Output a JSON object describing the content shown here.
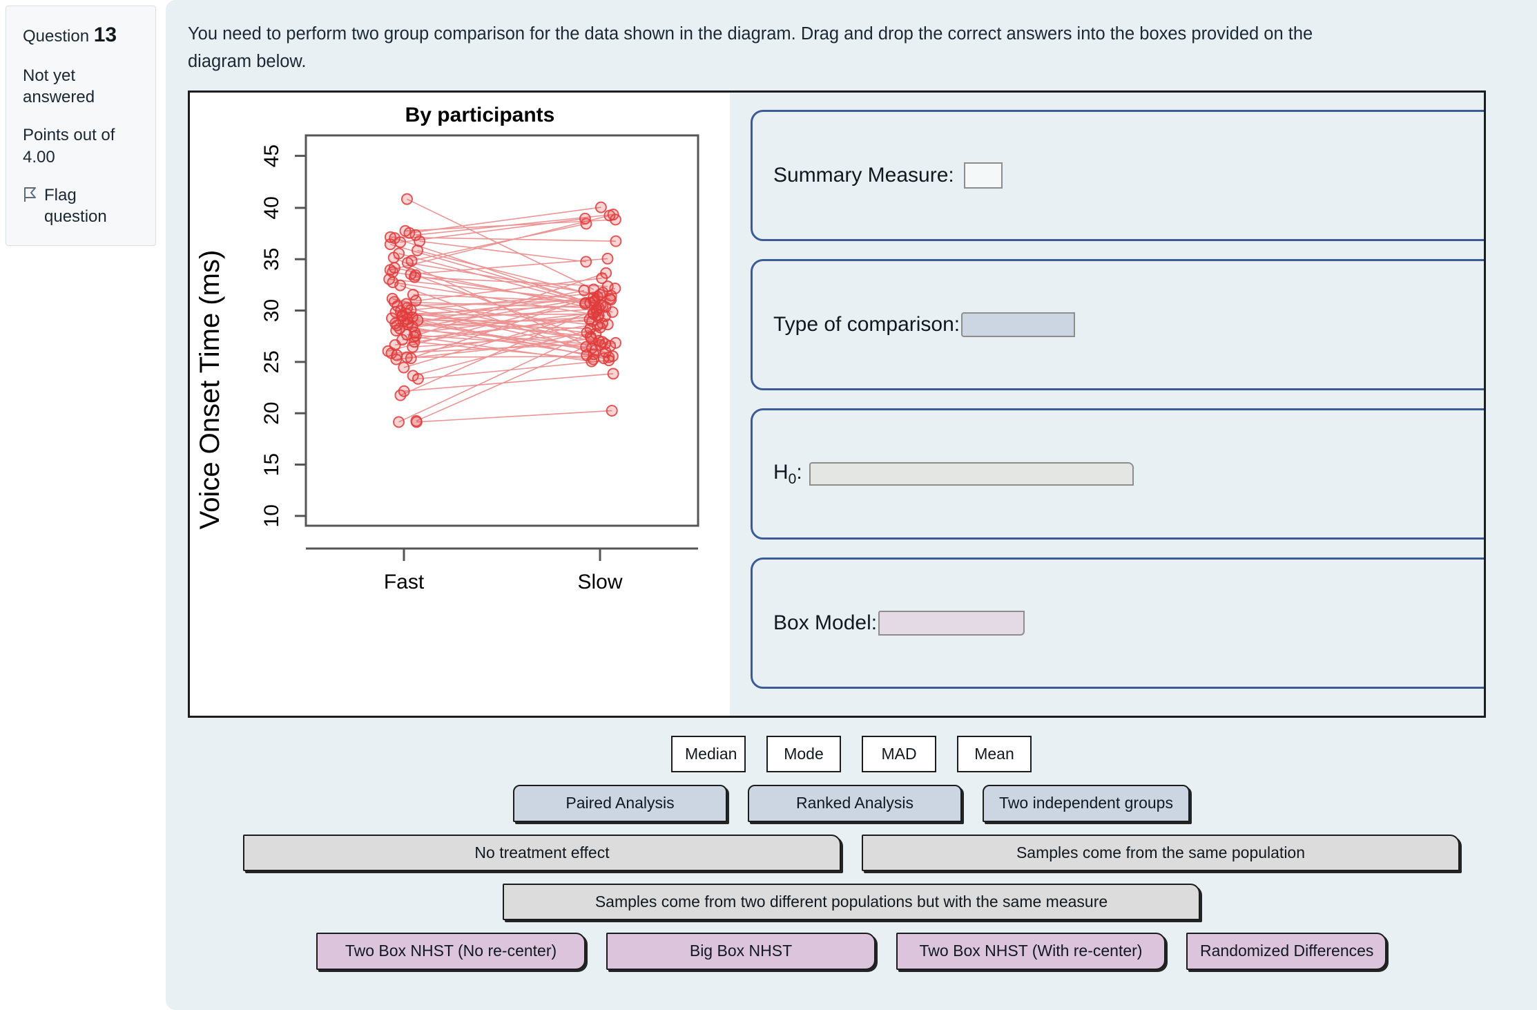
{
  "question_info": {
    "question_word": "Question",
    "question_number": "13",
    "status": "Not yet answered",
    "points": "Points out of 4.00",
    "flag_label": "Flag question",
    "flag_icon": "flag-icon"
  },
  "prompt": "You need to perform two group comparison for the data shown in the diagram. Drag and drop the correct answers into the boxes provided on the diagram below.",
  "zones": [
    {
      "label": "Summary Measure:",
      "slot_style": "slot-summary",
      "name": "summary-measure"
    },
    {
      "label": "Type of comparison:",
      "slot_style": "slot-type",
      "name": "type-of-comparison"
    },
    {
      "label_html": "H0:",
      "label_main": "H",
      "label_sub": "0",
      "label_colon": ":",
      "slot_style": "slot-h0",
      "name": "null-hypothesis"
    },
    {
      "label": "Box Model:",
      "slot_style": "slot-box",
      "name": "box-model"
    }
  ],
  "answer_chips": {
    "row1": [
      "Median",
      "Mode",
      "MAD",
      "Mean"
    ],
    "row2": [
      "Paired Analysis",
      "Ranked Analysis",
      "Two independent groups"
    ],
    "row3": [
      "No treatment effect",
      "Samples come from the same population"
    ],
    "row4": [
      "Samples come from two different populations but with the same measure"
    ],
    "row5": [
      "Two Box NHST (No re-center)",
      "Big Box NHST",
      "Two Box NHST (With re-center)",
      "Randomized Differences"
    ]
  },
  "colors": {
    "page_background": "#e9f0f4",
    "zone_border": "#3b5a97",
    "chip_white": "#ffffff",
    "chip_blue": "#ccd6e3",
    "chip_gray": "#dcdcdc",
    "chip_purple": "#dcc5dc",
    "plot_point": "#e03c3c"
  },
  "chart_data": {
    "type": "line",
    "title": "By participants",
    "xlabel": "",
    "ylabel": "Voice Onset Time (ms)",
    "categories": [
      "Fast",
      "Slow"
    ],
    "xtick_labels": [
      "Fast",
      "Slow"
    ],
    "ytick_labels": [
      "10",
      "15",
      "20",
      "25",
      "30",
      "35",
      "40",
      "45"
    ],
    "yticks": [
      10,
      15,
      20,
      25,
      30,
      35,
      40,
      45
    ],
    "ylim": [
      8.5,
      46.5
    ],
    "grid": false,
    "legend": null,
    "series_description": "Paired participant lines connecting Fast to Slow condition",
    "pairs": [
      [
        40.3,
        31.5
      ],
      [
        37.2,
        38.3
      ],
      [
        37.0,
        39.5
      ],
      [
        36.8,
        38.8
      ],
      [
        36.6,
        36.2
      ],
      [
        36.5,
        30.2
      ],
      [
        36.2,
        34.2
      ],
      [
        36.1,
        38.4
      ],
      [
        35.9,
        29.8
      ],
      [
        35.3,
        30.6
      ],
      [
        34.3,
        37.9
      ],
      [
        34.1,
        31.0
      ],
      [
        33.6,
        29.3
      ],
      [
        33.4,
        38.7
      ],
      [
        33.2,
        30.1
      ],
      [
        33.0,
        34.5
      ],
      [
        32.9,
        26.0
      ],
      [
        32.7,
        31.8
      ],
      [
        32.5,
        30.4
      ],
      [
        32.2,
        28.9
      ],
      [
        31.9,
        25.2
      ],
      [
        31.0,
        30.3
      ],
      [
        30.4,
        32.6
      ],
      [
        30.3,
        29.7
      ],
      [
        30.1,
        28.0
      ],
      [
        29.9,
        30.5
      ],
      [
        29.7,
        25.6
      ],
      [
        29.5,
        31.2
      ],
      [
        29.4,
        26.4
      ],
      [
        29.3,
        27.3
      ],
      [
        29.1,
        30.0
      ],
      [
        29.0,
        29.1
      ],
      [
        28.9,
        25.1
      ],
      [
        28.8,
        26.9
      ],
      [
        28.7,
        30.9
      ],
      [
        28.6,
        24.8
      ],
      [
        28.5,
        28.4
      ],
      [
        28.4,
        29.6
      ],
      [
        28.3,
        25.4
      ],
      [
        28.2,
        27.7
      ],
      [
        28.1,
        31.4
      ],
      [
        28.0,
        24.9
      ],
      [
        27.9,
        28.8
      ],
      [
        27.7,
        26.1
      ],
      [
        27.5,
        30.7
      ],
      [
        27.3,
        29.2
      ],
      [
        27.1,
        25.9
      ],
      [
        27.0,
        33.1
      ],
      [
        26.6,
        28.6
      ],
      [
        26.4,
        24.7
      ],
      [
        26.1,
        29.0
      ],
      [
        25.9,
        27.2
      ],
      [
        25.5,
        30.8
      ],
      [
        25.3,
        26.3
      ],
      [
        25.1,
        28.2
      ],
      [
        24.9,
        25.0
      ],
      [
        24.8,
        31.6
      ],
      [
        24.7,
        26.7
      ],
      [
        23.9,
        29.4
      ],
      [
        23.1,
        27.8
      ],
      [
        22.8,
        24.6
      ],
      [
        21.6,
        23.3
      ],
      [
        21.2,
        29.9
      ],
      [
        18.7,
        26.5
      ],
      [
        18.6,
        28.1
      ],
      [
        18.6,
        19.7
      ],
      [
        34.6,
        25.8
      ],
      [
        35.0,
        30.2
      ],
      [
        30.6,
        26.2
      ],
      [
        26.9,
        24.5
      ]
    ]
  }
}
